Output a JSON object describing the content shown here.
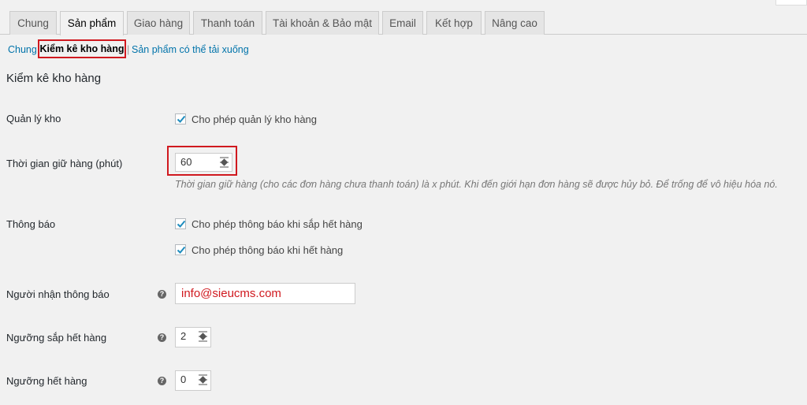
{
  "tabs": [
    {
      "label": "Chung"
    },
    {
      "label": "Sản phẩm",
      "active": true
    },
    {
      "label": "Giao hàng"
    },
    {
      "label": "Thanh toán"
    },
    {
      "label": "Tài khoản & Bảo mật"
    },
    {
      "label": "Email"
    },
    {
      "label": "Kết hợp"
    },
    {
      "label": "Nâng cao"
    }
  ],
  "subnav": {
    "general": "Chung",
    "current": "Kiểm kê kho hàng",
    "separator": "|",
    "downloadable": "Sản phẩm có thể tải xuống"
  },
  "section_title": "Kiểm kê kho hàng",
  "fields": {
    "manage_stock": {
      "label": "Quản lý kho",
      "checkbox_label": "Cho phép quản lý kho hàng",
      "checked": true
    },
    "hold_stock": {
      "label": "Thời gian giữ hàng (phút)",
      "value": "60",
      "description": "Thời gian giữ hàng (cho các đơn hàng chưa thanh toán) là x phút. Khi đến giới hạn đơn hàng sẽ được hủy bỏ. Để trống để vô hiệu hóa nó."
    },
    "notifications": {
      "label": "Thông báo",
      "low_stock_label": "Cho phép thông báo khi sắp hết hàng",
      "low_stock_checked": true,
      "out_of_stock_label": "Cho phép thông báo khi hết hàng",
      "out_of_stock_checked": true
    },
    "recipient": {
      "label": "Người nhận thông báo",
      "value": "info@sieucms.com"
    },
    "low_stock_threshold": {
      "label": "Ngưỡng sắp hết hàng",
      "value": "2"
    },
    "out_of_stock_threshold": {
      "label": "Ngưỡng hết hàng",
      "value": "0"
    }
  },
  "icons": {
    "help": "question-circle-icon",
    "check": "checkmark-icon",
    "spinner": "spinner-arrows-icon"
  },
  "colors": {
    "highlight": "#d0191f",
    "link": "#0073aa",
    "check": "#1e8cbe"
  }
}
